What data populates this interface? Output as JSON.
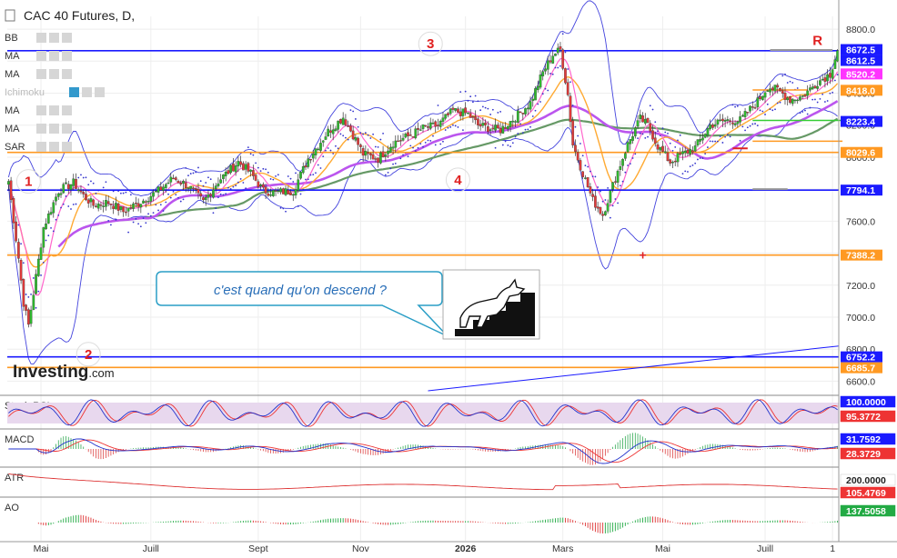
{
  "chart_data": {
    "type": "candlestick",
    "title": "CAC 40 Futures, D,",
    "brand": "Investing",
    "brand_suffix": ".com",
    "y_range": [
      6540,
      8880
    ],
    "y_ticks": [
      6600,
      6800,
      7000,
      7200,
      7400,
      7600,
      7800,
      8000,
      8200,
      8400,
      8600,
      8800
    ],
    "y_tick_labels": [
      "6600.0",
      "6800.0",
      "7000.0",
      "7200.0",
      "7400.0",
      "7600.0",
      "7800.0",
      "8000.0",
      "8200.0",
      "8400.0",
      "8600.0",
      "8800.0"
    ],
    "x_labels": [
      "Mai",
      "Juill",
      "Sept",
      "Nov",
      "2026",
      "Mars",
      "Mai",
      "Juill",
      "1"
    ],
    "x_label_index": [
      13,
      57,
      100,
      141,
      183,
      222,
      262,
      303,
      330
    ],
    "bar_count": 333,
    "close_anchors": [
      [
        0,
        7850
      ],
      [
        4,
        7370
      ],
      [
        6,
        7090
      ],
      [
        8,
        6950
      ],
      [
        10,
        7150
      ],
      [
        14,
        7560
      ],
      [
        20,
        7790
      ],
      [
        26,
        7840
      ],
      [
        30,
        7760
      ],
      [
        34,
        7700
      ],
      [
        40,
        7720
      ],
      [
        46,
        7660
      ],
      [
        54,
        7730
      ],
      [
        60,
        7790
      ],
      [
        66,
        7870
      ],
      [
        72,
        7820
      ],
      [
        78,
        7720
      ],
      [
        84,
        7850
      ],
      [
        92,
        7970
      ],
      [
        97,
        7900
      ],
      [
        102,
        7790
      ],
      [
        107,
        7780
      ],
      [
        114,
        7790
      ],
      [
        120,
        7990
      ],
      [
        128,
        8160
      ],
      [
        134,
        8250
      ],
      [
        138,
        8140
      ],
      [
        142,
        8020
      ],
      [
        148,
        7990
      ],
      [
        154,
        8090
      ],
      [
        160,
        8130
      ],
      [
        166,
        8180
      ],
      [
        172,
        8200
      ],
      [
        178,
        8290
      ],
      [
        184,
        8270
      ],
      [
        188,
        8200
      ],
      [
        193,
        8180
      ],
      [
        197,
        8170
      ],
      [
        203,
        8250
      ],
      [
        209,
        8340
      ],
      [
        214,
        8530
      ],
      [
        218,
        8640
      ],
      [
        221,
        8670
      ],
      [
        224,
        8390
      ],
      [
        226,
        8080
      ],
      [
        230,
        7900
      ],
      [
        234,
        7730
      ],
      [
        238,
        7640
      ],
      [
        243,
        7870
      ],
      [
        248,
        8080
      ],
      [
        253,
        8240
      ],
      [
        256,
        8200
      ],
      [
        260,
        8070
      ],
      [
        265,
        7970
      ],
      [
        270,
        8020
      ],
      [
        275,
        8060
      ],
      [
        281,
        8200
      ],
      [
        287,
        8230
      ],
      [
        293,
        8230
      ],
      [
        300,
        8350
      ],
      [
        304,
        8440
      ],
      [
        308,
        8420
      ],
      [
        313,
        8360
      ],
      [
        318,
        8380
      ],
      [
        324,
        8470
      ],
      [
        329,
        8520
      ],
      [
        332,
        8670
      ]
    ],
    "price_levels": [
      {
        "value": 8672.5,
        "label": "8672.5",
        "color": "#1a1aff"
      },
      {
        "value": 8612.5,
        "label": "8612.5",
        "color": "#1a1aff"
      },
      {
        "value": 8520.2,
        "label": "8520.2",
        "color": "#ff33ff"
      },
      {
        "value": 8418.0,
        "label": "8418.0",
        "color": "#ff9922"
      },
      {
        "value": 8223.4,
        "label": "8223.4",
        "color": "#1a1aff"
      },
      {
        "value": 8029.6,
        "label": "8029.6",
        "color": "#ff9922"
      },
      {
        "value": 7794.1,
        "label": "7794.1",
        "color": "#1a1aff"
      },
      {
        "value": 7388.2,
        "label": "7388.2",
        "color": "#ff9922"
      },
      {
        "value": 6752.2,
        "label": "6752.2",
        "color": "#1a1aff"
      },
      {
        "value": 6685.7,
        "label": "6685.7",
        "color": "#ff9922"
      }
    ],
    "horizontal_lines": [
      {
        "value": 8665,
        "color": "#1a1aff"
      },
      {
        "value": 7794.1,
        "color": "#1a1aff"
      },
      {
        "value": 6752.2,
        "color": "#1a1aff"
      },
      {
        "value": 8029.6,
        "color": "#ff9922"
      },
      {
        "value": 7388.2,
        "color": "#ff9922"
      },
      {
        "value": 6685.7,
        "color": "#ff9922"
      }
    ],
    "indicators": [
      "BB",
      "MA",
      "MA",
      "Ichimoku",
      "MA",
      "MA",
      "SAR"
    ],
    "wave_labels": [
      {
        "text": "1",
        "bar": 8,
        "value": 7820
      },
      {
        "text": "2",
        "bar": 32,
        "value": 6740
      },
      {
        "text": "3",
        "bar": 169,
        "value": 8680
      },
      {
        "text": "4",
        "bar": 180,
        "value": 7830
      },
      {
        "text": "R",
        "bar": 324,
        "value": 8700
      }
    ],
    "annotation": "c'est quand qu'on descend ?",
    "panels": [
      {
        "name": "Stoch RSI",
        "values": [
          "100.0000",
          "95.3772"
        ],
        "colors": [
          "#1a1aff",
          "#ee3333"
        ]
      },
      {
        "name": "MACD",
        "values": [
          "31.7592",
          "28.3729"
        ],
        "colors": [
          "#1a1aff",
          "#ee3333"
        ]
      },
      {
        "name": "ATR",
        "values": [
          "200.0000",
          "105.4769"
        ],
        "colors": [
          "#ffffff",
          "#ee3333"
        ]
      },
      {
        "name": "AO",
        "values": [
          "137.5058"
        ],
        "colors": [
          "#22aa44"
        ]
      }
    ],
    "colors": {
      "up": "#2eb82e",
      "down": "#e03a3a",
      "bb": "#4444dd",
      "sar": "#3333cc",
      "ma_fast": "#ff66cc",
      "ma_mid": "#ffaa33",
      "ma_slow": "#bb55ee",
      "ma_long": "#669966"
    }
  }
}
